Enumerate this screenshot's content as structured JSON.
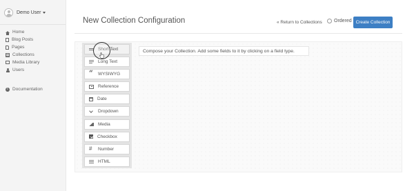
{
  "user": {
    "name": "Demo User"
  },
  "nav": {
    "items": [
      {
        "label": "Home",
        "icon": "home-icon"
      },
      {
        "label": "Blog Posts",
        "icon": "document-icon"
      },
      {
        "label": "Pages",
        "icon": "page-icon"
      },
      {
        "label": "Collections",
        "icon": "collections-icon"
      },
      {
        "label": "Media Library",
        "icon": "media-icon"
      },
      {
        "label": "Users",
        "icon": "user-icon"
      }
    ],
    "documentation": {
      "label": "Documentation",
      "icon": "info-icon"
    }
  },
  "header": {
    "title": "New Collection Configuration",
    "return_link": "« Return to Collections",
    "ordered_label": "Ordered",
    "create_button": "Create Collection"
  },
  "fields": [
    {
      "label": "Short Text",
      "icon": "short-text-icon"
    },
    {
      "label": "Long Text",
      "icon": "long-text-icon"
    },
    {
      "label": "WYSIWYG",
      "icon": "quote-icon"
    },
    {
      "label": "Reference",
      "icon": "reference-icon"
    },
    {
      "label": "Date",
      "icon": "calendar-icon"
    },
    {
      "label": "Dropdown",
      "icon": "chevron-down-icon"
    },
    {
      "label": "Media",
      "icon": "image-icon"
    },
    {
      "label": "Checkbox",
      "icon": "checkbox-icon"
    },
    {
      "label": "Number",
      "icon": "hash-icon"
    },
    {
      "label": "HTML",
      "icon": "list-icon"
    }
  ],
  "compose_hint": "Compose your Collection. Add some fields to it by clicking on a field type.",
  "colors": {
    "primary_button": "#3d7fc4",
    "background": "#f4f4f4"
  }
}
